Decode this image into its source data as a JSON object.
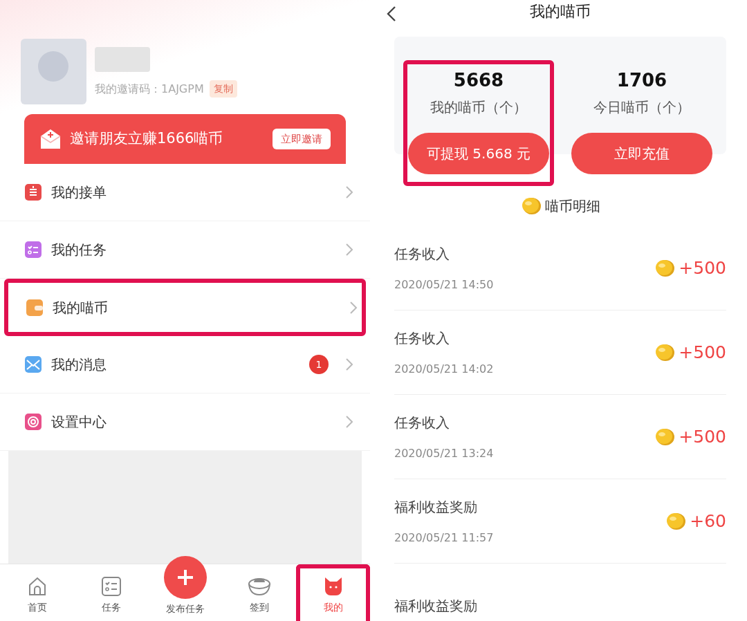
{
  "profile": {
    "invite_code_label": "我的邀请码：1AJGPM",
    "copy_button": "复制"
  },
  "invite_banner": {
    "text": "邀请朋友立赚1666喵币",
    "button": "立即邀请"
  },
  "menu": [
    {
      "label": "我的接单",
      "highlighted": false
    },
    {
      "label": "我的任务",
      "highlighted": false
    },
    {
      "label": "我的喵币",
      "highlighted": true
    },
    {
      "label": "我的消息",
      "highlighted": false,
      "badge": "1"
    },
    {
      "label": "设置中心",
      "highlighted": false
    }
  ],
  "bottom_nav": [
    {
      "label": "首页",
      "kind": "tab",
      "selected": false,
      "highlighted": false
    },
    {
      "label": "任务",
      "kind": "tab",
      "selected": false,
      "highlighted": false
    },
    {
      "label": "发布任务",
      "kind": "publish",
      "selected": false,
      "highlighted": false
    },
    {
      "label": "签到",
      "kind": "tab",
      "selected": false,
      "highlighted": false
    },
    {
      "label": "我的",
      "kind": "tab",
      "selected": true,
      "highlighted": true
    }
  ],
  "coin_page": {
    "title": "我的喵币",
    "stats": [
      {
        "value": "5668",
        "label": "我的喵币（个）",
        "button": "可提现 5.668 元",
        "highlighted": true
      },
      {
        "value": "1706",
        "label": "今日喵币（个）",
        "button": "立即充值",
        "highlighted": false
      }
    ],
    "detail_title": "喵币明细",
    "transactions": [
      {
        "title": "任务收入",
        "time": "2020/05/21 14:50",
        "amount": "+500"
      },
      {
        "title": "任务收入",
        "time": "2020/05/21 14:02",
        "amount": "+500"
      },
      {
        "title": "任务收入",
        "time": "2020/05/21 13:24",
        "amount": "+500"
      },
      {
        "title": "福利收益奖励",
        "time": "2020/05/21 11:57",
        "amount": "+60"
      },
      {
        "title": "福利收益奖励"
      }
    ]
  }
}
